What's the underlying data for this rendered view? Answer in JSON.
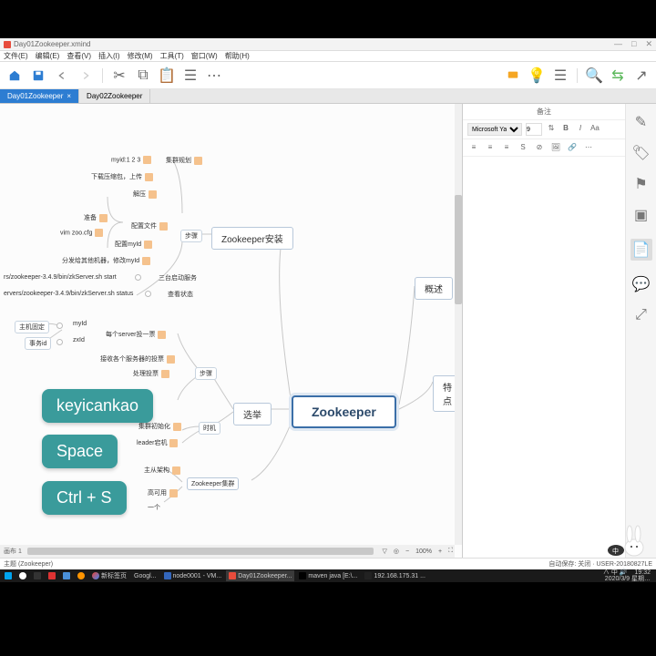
{
  "title": "Day01Zookeeper.xmind",
  "menubar": [
    "文件(E)",
    "编辑(E)",
    "查看(V)",
    "插入(I)",
    "修改(M)",
    "工具(T)",
    "窗口(W)",
    "帮助(H)"
  ],
  "tabs": [
    {
      "label": "Day01Zookeeper",
      "active": true
    },
    {
      "label": "Day02Zookeeper",
      "active": false
    }
  ],
  "central": "Zookeeper",
  "mains": {
    "install": "Zookeeper安装",
    "overview": "概述",
    "feature": "特点",
    "election": "选举",
    "cluster": "Zookeeper集群"
  },
  "sub": {
    "plan": "集群规划",
    "myid": "myid:1 2 3",
    "upload": "下载压缩包，上传",
    "unzip": "解压",
    "prepare": "准备",
    "cfgfile": "配置文件",
    "vimzoo": "vim zoo.cfg",
    "cfgmyid": "配置myId",
    "distribute": "分发给其他机器，修改myId",
    "startscript": "rs/zookeeper-3.4.9/bin/zkServer.sh start",
    "statusscript": "ervers/zookeeper-3.4.9/bin/zkServer.sh status",
    "threestart": "三台启动服务",
    "viewstatus": "查看状态",
    "steps": "步骤",
    "hostfix": "主机固定",
    "myid2": "myId",
    "txid": "事务id",
    "zxid": "zxId",
    "votepersrv": "每个server投一票",
    "recvvote": "接收各个服务器的投票",
    "handlevote": "处理投票",
    "steps2": "步骤",
    "init": "集群初始化",
    "timing": "时机",
    "leaderdown": "leader宕机",
    "ms": "主从架构",
    "ha": "高可用",
    "one": "一个"
  },
  "overlays": {
    "k1": "keyicankao",
    "k2": "Space",
    "k3": "Ctrl + S"
  },
  "notes": {
    "header": "备注",
    "font": "Microsoft Ya...",
    "size": "9"
  },
  "canvas_footer": "画布 1",
  "zoom": "100%",
  "status_left": "主题 (Zookeeper)",
  "status_right": "自动保存: 关闭  ·  USER-20180827LE",
  "taskbar": {
    "items": [
      "",
      "",
      "",
      "",
      "",
      "新标签页",
      "Googl...",
      "node0001 - VM...",
      "Day01Zookeeper...",
      "maven java [E:\\...",
      "192.168.175.31 ..."
    ],
    "rhs": "中",
    "time": "19:32",
    "date": "2020/3/9 星期…"
  }
}
